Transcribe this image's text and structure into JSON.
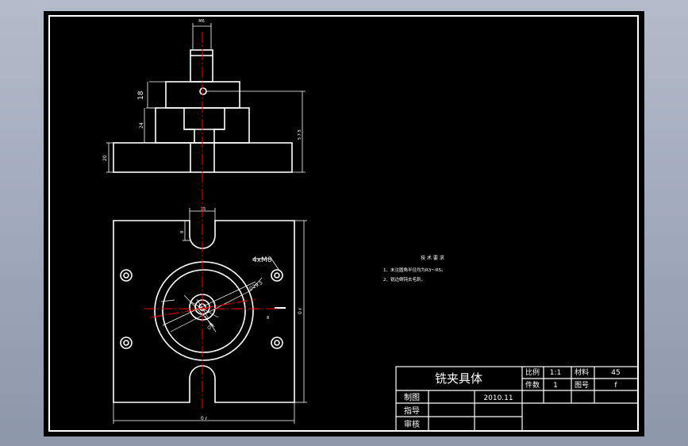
{
  "colors": {
    "background": "#9aa4b6",
    "sheet": "#000000",
    "line": "#ffffff",
    "center_line": "#ff0000"
  },
  "top_view": {
    "dims": {
      "thread": "M6",
      "h18": "18",
      "h24": "24",
      "h20": "20",
      "total": "5 7 5"
    }
  },
  "plan_view": {
    "dims": {
      "slot": "15",
      "slot_depth": "8",
      "holes": "4xM8",
      "height": "0 r",
      "width": "0 r",
      "dia_large": "∅29.5",
      "dia_small": "∅8",
      "angle": "8"
    }
  },
  "notes": {
    "title": "技 术 要 求",
    "items": [
      "1、未注圆角半径均为R3～R5。",
      "2、锐边倒钝去毛刺。"
    ]
  },
  "title_block": {
    "part_name": "铣夹具体",
    "scale_label": "比例",
    "scale_value": "1:1",
    "material_label": "材料",
    "material_value": "45",
    "qty_label": "件数",
    "qty_value": "1",
    "drawing_no_label": "图号",
    "drawing_no_value": "f",
    "drawn_label": "制图",
    "date": "2010.11",
    "guide_label": "指导",
    "review_label": "审核"
  }
}
